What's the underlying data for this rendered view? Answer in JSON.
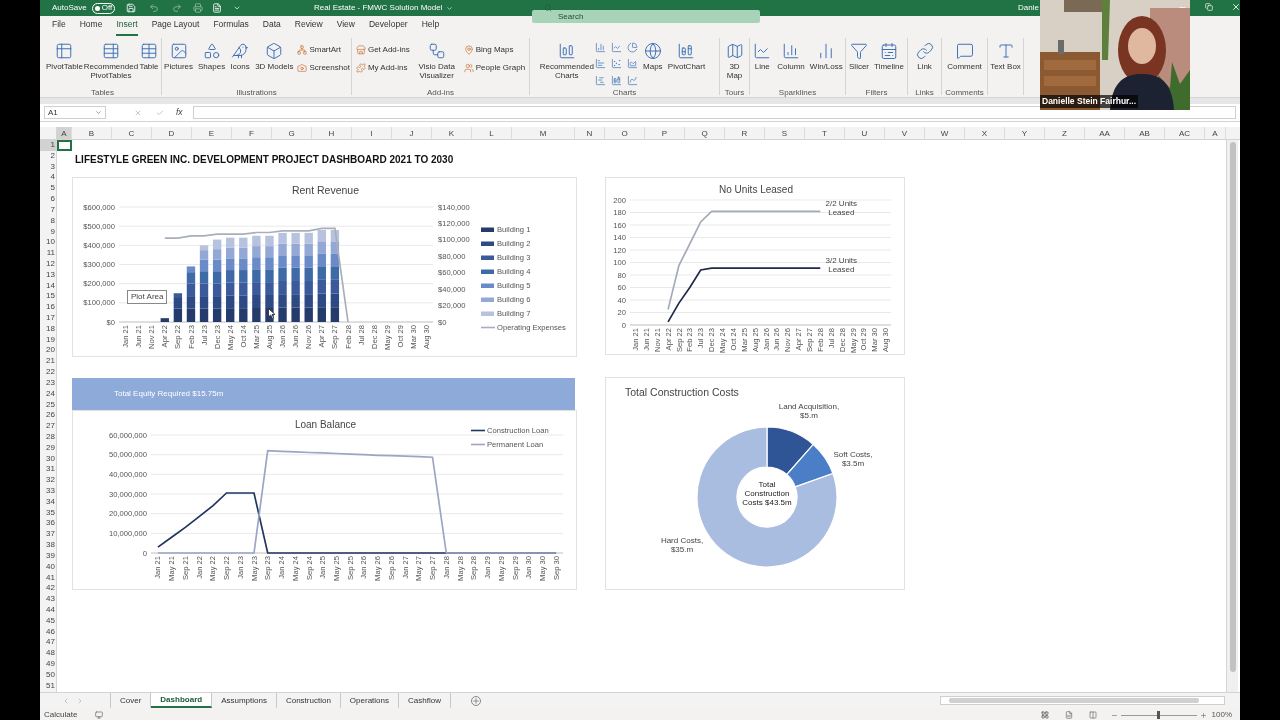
{
  "title_bar": {
    "autosave_label": "AutoSave",
    "autosave_toggle": {
      "label": "Off",
      "on": false
    },
    "title": "Real Estate - FMWC Solution Model",
    "search": {
      "placeholder": "Search"
    },
    "user": "Danie"
  },
  "ribbon_tabs": [
    {
      "label": "File",
      "selected": false
    },
    {
      "label": "Home",
      "selected": false
    },
    {
      "label": "Insert",
      "selected": true
    },
    {
      "label": "Page Layout",
      "selected": false
    },
    {
      "label": "Formulas",
      "selected": false
    },
    {
      "label": "Data",
      "selected": false
    },
    {
      "label": "Review",
      "selected": false
    },
    {
      "label": "View",
      "selected": false
    },
    {
      "label": "Developer",
      "selected": false
    },
    {
      "label": "Help",
      "selected": false
    }
  ],
  "ribbon_groups": [
    {
      "name": "Tables",
      "items": [
        {
          "kind": "large",
          "label": "PivotTable"
        },
        {
          "kind": "large",
          "label": "Recommended PivotTables"
        },
        {
          "kind": "large",
          "label": "Table"
        }
      ]
    },
    {
      "name": "Illustrations",
      "items": [
        {
          "kind": "large",
          "label": "Pictures"
        },
        {
          "kind": "large",
          "label": "Shapes"
        },
        {
          "kind": "large",
          "label": "Icons"
        },
        {
          "kind": "large",
          "label": "3D Models"
        },
        {
          "kind": "small",
          "label": "SmartArt"
        },
        {
          "kind": "small",
          "label": "Screenshot"
        }
      ]
    },
    {
      "name": "Add-ins",
      "items": [
        {
          "kind": "small",
          "label": "Get Add-ins"
        },
        {
          "kind": "small",
          "label": "My Add-ins"
        },
        {
          "kind": "large",
          "label": "Visio Data Visualizer"
        },
        {
          "kind": "small",
          "label": "Bing Maps"
        },
        {
          "kind": "small",
          "label": "People Graph"
        }
      ]
    },
    {
      "name": "Charts",
      "items": [
        {
          "kind": "large",
          "label": "Recommended Charts"
        },
        {
          "kind": "icon_grid"
        },
        {
          "kind": "large",
          "label": "Maps"
        },
        {
          "kind": "large",
          "label": "PivotChart"
        }
      ]
    },
    {
      "name": "Tours",
      "items": [
        {
          "kind": "large",
          "label": "3D Map"
        }
      ]
    },
    {
      "name": "Sparklines",
      "items": [
        {
          "kind": "large",
          "label": "Line"
        },
        {
          "kind": "large",
          "label": "Column"
        },
        {
          "kind": "large",
          "label": "Win/Loss"
        }
      ]
    },
    {
      "name": "Filters",
      "items": [
        {
          "kind": "large",
          "label": "Slicer"
        },
        {
          "kind": "large",
          "label": "Timeline"
        }
      ]
    },
    {
      "name": "Links",
      "items": [
        {
          "kind": "large",
          "label": "Link"
        }
      ]
    },
    {
      "name": "Comments",
      "items": [
        {
          "kind": "large",
          "label": "Comment"
        }
      ]
    },
    {
      "items": [
        {
          "kind": "large",
          "label": "Text Box"
        }
      ]
    }
  ],
  "formula_bar": {
    "name_box": "A1",
    "fx": "fx"
  },
  "columns": [
    "A",
    "B",
    "C",
    "D",
    "E",
    "F",
    "G",
    "H",
    "I",
    "J",
    "K",
    "L",
    "M",
    "N",
    "O",
    "P",
    "Q",
    "R",
    "S",
    "T",
    "U",
    "V",
    "W",
    "X",
    "Y",
    "Z",
    "AA",
    "AB",
    "AC",
    "A"
  ],
  "rows": [
    "1",
    "2",
    "3",
    "4",
    "5",
    "6",
    "7",
    "8",
    "9",
    "10",
    "11",
    "12",
    "13",
    "14",
    "15",
    "16",
    "17",
    "18",
    "19",
    "20",
    "21",
    "22",
    "23",
    "24",
    "25",
    "26",
    "27",
    "28",
    "29",
    "30",
    "31",
    "32",
    "33",
    "34",
    "35",
    "36",
    "37",
    "38",
    "39",
    "40",
    "41",
    "42",
    "43",
    "44",
    "45",
    "46",
    "47",
    "48",
    "49",
    "50",
    "51"
  ],
  "dashboard": {
    "title": "LIFESTYLE GREEN INC. DEVELOPMENT PROJECT DASHBOARD 2021 TO 2030",
    "rent_revenue": {
      "tooltip": "Plot Area",
      "chart_data": {
        "type": "bar",
        "title": "Rent Revenue",
        "stacked": true,
        "grid": true,
        "legend": "right",
        "categories": [
          "Jan 21",
          "Jun 21",
          "Nov 21",
          "Apr 22",
          "Sep 22",
          "Feb 23",
          "Jul 23",
          "Dec 23",
          "May 24",
          "Oct 24",
          "Mar 25",
          "Aug 25",
          "Jan 26",
          "Jun 26",
          "Nov 26",
          "Apr 27",
          "Sep 27",
          "Feb 28",
          "Jul 28",
          "Dec 28",
          "May 29",
          "Oct 29",
          "Mar 30",
          "Aug 30"
        ],
        "ylim": [
          0,
          600000
        ],
        "yticks": [
          {
            "value": 0,
            "label": "$0"
          },
          {
            "value": 100000,
            "label": "$100,000"
          },
          {
            "value": 200000,
            "label": "$200,000"
          },
          {
            "value": 300000,
            "label": "$300,000"
          },
          {
            "value": 400000,
            "label": "$400,000"
          },
          {
            "value": 500000,
            "label": "$500,000"
          },
          {
            "value": 600000,
            "label": "$600,000"
          }
        ],
        "y2lim": [
          0,
          140000
        ],
        "y2ticks": [
          {
            "value": 0,
            "label": "$0"
          },
          {
            "value": 20000,
            "label": "$20,000"
          },
          {
            "value": 40000,
            "label": "$40,000"
          },
          {
            "value": 60000,
            "label": "$60,000"
          },
          {
            "value": 80000,
            "label": "$80,000"
          },
          {
            "value": 100000,
            "label": "$100,000"
          },
          {
            "value": 120000,
            "label": "$120,000"
          },
          {
            "value": 140000,
            "label": "$140,000"
          }
        ],
        "series": [
          {
            "name": "Building 1",
            "color": "#243b6b",
            "values": [
              0,
              0,
              0,
              20000,
              70000,
              70000,
              70000,
              70000,
              72000,
              72000,
              73000,
              73000,
              75000,
              75000,
              75000,
              77000,
              77000,
              0,
              0,
              0,
              0,
              0,
              0,
              0
            ]
          },
          {
            "name": "Building 2",
            "color": "#2d4a85",
            "values": [
              0,
              0,
              0,
              0,
              60000,
              65000,
              65000,
              65000,
              67000,
              67000,
              68000,
              68000,
              70000,
              70000,
              70000,
              72000,
              72000,
              0,
              0,
              0,
              0,
              0,
              0,
              0
            ]
          },
          {
            "name": "Building 3",
            "color": "#3a5a9c",
            "values": [
              0,
              0,
              0,
              0,
              20000,
              65000,
              65000,
              65000,
              66000,
              66000,
              67000,
              67000,
              69000,
              69000,
              69000,
              71000,
              71000,
              0,
              0,
              0,
              0,
              0,
              0,
              0
            ]
          },
          {
            "name": "Building 4",
            "color": "#3f6aa8",
            "values": [
              0,
              0,
              0,
              0,
              0,
              60000,
              65000,
              65000,
              66000,
              66000,
              67000,
              67000,
              69000,
              69000,
              69000,
              71000,
              71000,
              0,
              0,
              0,
              0,
              0,
              0,
              0
            ]
          },
          {
            "name": "Building 5",
            "color": "#6a8bc8",
            "values": [
              0,
              0,
              0,
              0,
              0,
              30000,
              60000,
              60000,
              61000,
              61000,
              63000,
              63000,
              65000,
              65000,
              65000,
              67000,
              67000,
              0,
              0,
              0,
              0,
              0,
              0,
              0
            ]
          },
          {
            "name": "Building 6",
            "color": "#93a8d4",
            "values": [
              0,
              0,
              0,
              0,
              0,
              0,
              50000,
              55000,
              56000,
              56000,
              58000,
              58000,
              61000,
              61000,
              61000,
              63000,
              63000,
              0,
              0,
              0,
              0,
              0,
              0,
              0
            ]
          },
          {
            "name": "Building 7",
            "color": "#b6c2de",
            "values": [
              0,
              0,
              0,
              0,
              0,
              0,
              25000,
              50000,
              52000,
              52000,
              54000,
              54000,
              56000,
              56000,
              56000,
              59000,
              59000,
              0,
              0,
              0,
              0,
              0,
              0,
              0
            ]
          },
          {
            "name": "Operating Expenses",
            "color": "#a9afba",
            "type": "line",
            "axis": "y2",
            "values": [
              null,
              null,
              null,
              102000,
              102000,
              105000,
              105000,
              107000,
              107000,
              107000,
              109000,
              109000,
              111000,
              111000,
              111000,
              114000,
              114000,
              0,
              null,
              null,
              null,
              null,
              null,
              null
            ]
          }
        ]
      }
    },
    "units_leased": {
      "chart_data": {
        "type": "line",
        "title": "No Units Leased",
        "grid": true,
        "categories": [
          "Jan 21",
          "Jun 21",
          "Nov 21",
          "Apr 22",
          "Sep 22",
          "Feb 23",
          "Jul 23",
          "Dec 23",
          "May 24",
          "Oct 24",
          "Mar 25",
          "Aug 25",
          "Jan 26",
          "Jun 26",
          "Nov 26",
          "Apr 27",
          "Sep 27",
          "Feb 28",
          "Jul 28",
          "Dec 28",
          "May 29",
          "Oct 29",
          "Mar 30",
          "Aug 30"
        ],
        "ylim": [
          0,
          200
        ],
        "yticks": [
          0,
          20,
          40,
          60,
          80,
          100,
          120,
          140,
          160,
          180,
          200
        ],
        "series": [
          {
            "name": "2/2 Units Leased",
            "color": "#a3aab8",
            "values": [
              null,
              null,
              null,
              25,
              95,
              130,
              165,
              182,
              182,
              182,
              182,
              182,
              182,
              182,
              182,
              182,
              182,
              182,
              null,
              null,
              null,
              null,
              null,
              null
            ]
          },
          {
            "name": "3/2 Units Leased",
            "color": "#1f2a4a",
            "values": [
              null,
              null,
              null,
              5,
              35,
              60,
              88,
              91,
              91,
              91,
              91,
              91,
              91,
              91,
              91,
              91,
              91,
              91,
              null,
              null,
              null,
              null,
              null,
              null
            ]
          }
        ]
      }
    },
    "equity_banner": "Total Equity Required $15.75m",
    "loan_balance": {
      "chart_data": {
        "type": "line",
        "title": "Loan Balance",
        "grid": true,
        "legend": "top-right",
        "categories": [
          "Jan 21",
          "May 21",
          "Sep 21",
          "Jan 22",
          "May 22",
          "Sep 22",
          "Jan 23",
          "May 23",
          "Sep 23",
          "Jan 24",
          "May 24",
          "Sep 24",
          "Jan 25",
          "May 25",
          "Sep 25",
          "Jan 26",
          "May 26",
          "Sep 26",
          "Jan 27",
          "May 27",
          "Sep 27",
          "Jan 28",
          "May 28",
          "Sep 28",
          "Jan 29",
          "May 29",
          "Sep 29",
          "Jan 30",
          "May 30",
          "Sep 30"
        ],
        "ylim": [
          0,
          60000000
        ],
        "yticks": [
          {
            "value": 0,
            "label": "0"
          },
          {
            "value": 10000000,
            "label": "10,000,000"
          },
          {
            "value": 20000000,
            "label": "20,000,000"
          },
          {
            "value": 30000000,
            "label": "30,000,000"
          },
          {
            "value": 40000000,
            "label": "40,000,000"
          },
          {
            "value": 50000000,
            "label": "50,000,000"
          },
          {
            "value": 60000000,
            "label": "60,000,000"
          }
        ],
        "series": [
          {
            "name": "Construction Loan",
            "color": "#1f3560",
            "values": [
              3000000,
              8000000,
              13000000,
              18500000,
              24000000,
              30500000,
              30500000,
              30500000,
              0,
              0,
              0,
              0,
              0,
              0,
              0,
              0,
              0,
              0,
              0,
              0,
              0,
              0,
              0,
              0,
              0,
              0,
              0,
              0,
              0,
              0
            ]
          },
          {
            "name": "Permanent Loan",
            "color": "#9aa6c4",
            "values": [
              0,
              0,
              0,
              0,
              0,
              0,
              0,
              0,
              52000000,
              51700000,
              51400000,
              51100000,
              50900000,
              50600000,
              50300000,
              50000000,
              49700000,
              49500000,
              49200000,
              49000000,
              48700000,
              0,
              0,
              0,
              0,
              0,
              0,
              0,
              0,
              0
            ]
          }
        ]
      }
    },
    "construction_costs": {
      "chart_data": {
        "type": "donut",
        "title": "Total Construction Costs",
        "values": [
          5,
          3.5,
          35
        ],
        "value_labels": [
          "Land Acquisition, $5.m",
          "Soft Costs, $3.5m",
          "Hard Costs, $35.m"
        ],
        "annotations": [
          {
            "text": "Total Construction Costs $43.5m"
          }
        ]
      }
    }
  },
  "sheet_tabs": [
    {
      "label": "Cover",
      "selected": false
    },
    {
      "label": "Dashboard",
      "selected": true
    },
    {
      "label": "Assumptions",
      "selected": false
    },
    {
      "label": "Construction",
      "selected": false
    },
    {
      "label": "Operations",
      "selected": false
    },
    {
      "label": "Cashflow",
      "selected": false
    }
  ],
  "status_bar": {
    "mode": "Calculate",
    "zoom_slider": {
      "level": 0.5
    },
    "zoom": "100%"
  },
  "video_call": {
    "kind": "picture",
    "participant": "Danielle Stein Fairhur..."
  }
}
